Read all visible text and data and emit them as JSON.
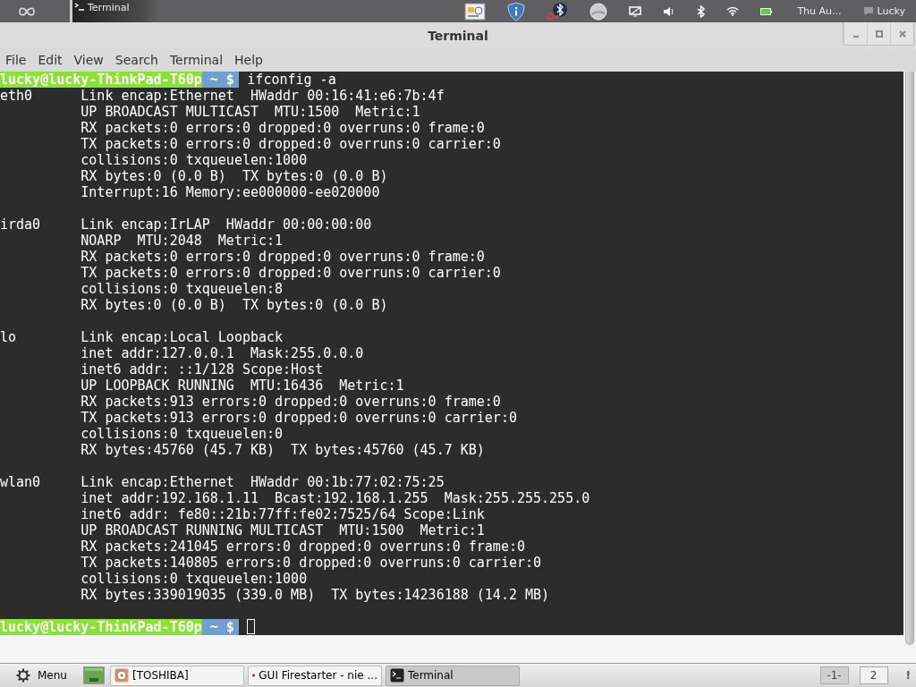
{
  "top_panel": {
    "tasks": [
      {
        "label": "Terminal"
      }
    ],
    "clock": "Thu Au...",
    "user": "Lucky"
  },
  "window": {
    "title": "Terminal"
  },
  "menu": [
    "File",
    "Edit",
    "View",
    "Search",
    "Terminal",
    "Help"
  ],
  "terminal": {
    "lines": [
      {
        "kind": "prompt",
        "user_host": "lucky@lucky-ThinkPad-T60p",
        "path": " ~ $",
        "command": "ifconfig -a"
      },
      {
        "kind": "output",
        "iface": "eth0",
        "text": "Link encap:Ethernet  HWaddr 00:16:41:e6:7b:4f"
      },
      {
        "kind": "output",
        "text": "UP BROADCAST MULTICAST  MTU:1500  Metric:1"
      },
      {
        "kind": "output",
        "text": "RX packets:0 errors:0 dropped:0 overruns:0 frame:0"
      },
      {
        "kind": "output",
        "text": "TX packets:0 errors:0 dropped:0 overruns:0 carrier:0"
      },
      {
        "kind": "output",
        "text": "collisions:0 txqueuelen:1000"
      },
      {
        "kind": "output",
        "text": "RX bytes:0 (0.0 B)  TX bytes:0 (0.0 B)"
      },
      {
        "kind": "output",
        "text": "Interrupt:16 Memory:ee000000-ee020000"
      },
      {
        "kind": "blank"
      },
      {
        "kind": "output",
        "iface": "irda0",
        "text": "Link encap:IrLAP  HWaddr 00:00:00:00"
      },
      {
        "kind": "output",
        "text": "NOARP  MTU:2048  Metric:1"
      },
      {
        "kind": "output",
        "text": "RX packets:0 errors:0 dropped:0 overruns:0 frame:0"
      },
      {
        "kind": "output",
        "text": "TX packets:0 errors:0 dropped:0 overruns:0 carrier:0"
      },
      {
        "kind": "output",
        "text": "collisions:0 txqueuelen:8"
      },
      {
        "kind": "output",
        "text": "RX bytes:0 (0.0 B)  TX bytes:0 (0.0 B)"
      },
      {
        "kind": "blank"
      },
      {
        "kind": "output",
        "iface": "lo",
        "text": "Link encap:Local Loopback"
      },
      {
        "kind": "output",
        "text": "inet addr:127.0.0.1  Mask:255.0.0.0"
      },
      {
        "kind": "output",
        "text": "inet6 addr: ::1/128 Scope:Host"
      },
      {
        "kind": "output",
        "text": "UP LOOPBACK RUNNING  MTU:16436  Metric:1"
      },
      {
        "kind": "output",
        "text": "RX packets:913 errors:0 dropped:0 overruns:0 frame:0"
      },
      {
        "kind": "output",
        "text": "TX packets:913 errors:0 dropped:0 overruns:0 carrier:0"
      },
      {
        "kind": "output",
        "text": "collisions:0 txqueuelen:0"
      },
      {
        "kind": "output",
        "text": "RX bytes:45760 (45.7 KB)  TX bytes:45760 (45.7 KB)"
      },
      {
        "kind": "blank"
      },
      {
        "kind": "output",
        "iface": "wlan0",
        "text": "Link encap:Ethernet  HWaddr 00:1b:77:02:75:25"
      },
      {
        "kind": "output",
        "text": "inet addr:192.168.1.11  Bcast:192.168.1.255  Mask:255.255.255.0"
      },
      {
        "kind": "output",
        "text": "inet6 addr: fe80::21b:77ff:fe02:7525/64 Scope:Link"
      },
      {
        "kind": "output",
        "text": "UP BROADCAST RUNNING MULTICAST  MTU:1500  Metric:1"
      },
      {
        "kind": "output",
        "text": "RX packets:241045 errors:0 dropped:0 overruns:0 frame:0"
      },
      {
        "kind": "output",
        "text": "TX packets:140805 errors:0 dropped:0 overruns:0 carrier:0"
      },
      {
        "kind": "output",
        "text": "collisions:0 txqueuelen:1000"
      },
      {
        "kind": "output",
        "text": "RX bytes:339019035 (339.0 MB)  TX bytes:14236188 (14.2 MB)"
      },
      {
        "kind": "blank"
      },
      {
        "kind": "prompt",
        "user_host": "lucky@lucky-ThinkPad-T60p",
        "path": " ~ $",
        "cursor": true
      }
    ]
  },
  "taskbar": {
    "menu_label": "Menu",
    "tasks": [
      {
        "label": "[TOSHIBA]",
        "kind": "disk",
        "selected": false
      },
      {
        "label": "GUI Firestarter - nie ...",
        "kind": "firewall",
        "selected": false
      },
      {
        "label": "Terminal",
        "kind": "terminal",
        "selected": true
      }
    ],
    "workspaces": [
      {
        "label": "-1-",
        "selected": true
      },
      {
        "label": "2",
        "selected": false
      }
    ],
    "notice": "!"
  }
}
